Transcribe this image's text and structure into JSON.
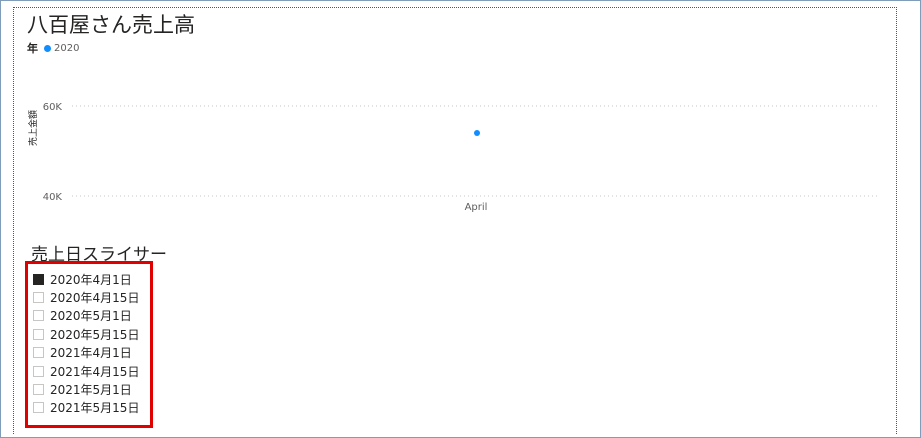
{
  "chart": {
    "title": "八百屋さん売上高",
    "legend_title": "年",
    "legend_items": [
      {
        "label": "2020",
        "color": "#118dff"
      }
    ]
  },
  "chart_data": {
    "type": "scatter",
    "title": "八百屋さん売上高",
    "xlabel": "",
    "ylabel": "売上金額",
    "categories": [
      "April"
    ],
    "series": [
      {
        "name": "2020",
        "values": [
          54000
        ],
        "color": "#118dff"
      }
    ],
    "y_ticks": [
      "60K",
      "40K"
    ],
    "ylim": [
      40000,
      60000
    ],
    "grid": true,
    "legend_position": "top-left"
  },
  "slicer": {
    "title": "売上日スライサー",
    "items": [
      {
        "label": "2020年4月1日",
        "checked": true
      },
      {
        "label": "2020年4月15日",
        "checked": false
      },
      {
        "label": "2020年5月1日",
        "checked": false
      },
      {
        "label": "2020年5月15日",
        "checked": false
      },
      {
        "label": "2021年4月1日",
        "checked": false
      },
      {
        "label": "2021年4月15日",
        "checked": false
      },
      {
        "label": "2021年5月1日",
        "checked": false
      },
      {
        "label": "2021年5月15日",
        "checked": false
      }
    ]
  }
}
